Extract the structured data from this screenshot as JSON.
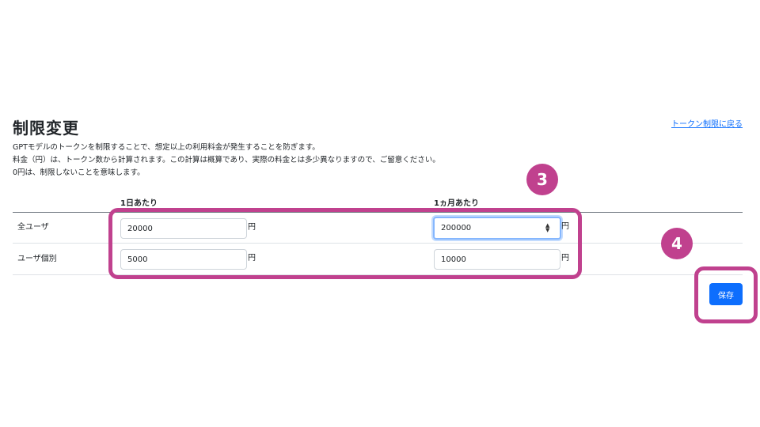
{
  "header": {
    "title": "制限変更",
    "back_link": "トークン制限に戻る"
  },
  "description": [
    "GPTモデルのトークンを制限することで、想定以上の利用料金が発生することを防ぎます。",
    "料金（円）は、トークン数から計算されます。この計算は概算であり、実際の料金とは多少異なりますので、ご留意ください。",
    "0円は、制限しないことを意味します。"
  ],
  "table": {
    "columns": [
      "1日あたり",
      "1ヵ月あたり"
    ],
    "unit": "円",
    "rows": [
      {
        "label": "全ユーザ",
        "daily": "20000",
        "monthly": "200000"
      },
      {
        "label": "ユーザ個別",
        "daily": "5000",
        "monthly": "10000"
      }
    ]
  },
  "annotations": {
    "step_inputs": "3",
    "step_save": "4"
  },
  "actions": {
    "save_label": "保存"
  },
  "colors": {
    "accent": "#0d6efd",
    "highlight": "#c0418e"
  },
  "icons": {
    "spinner": "number-spinner-icon"
  }
}
